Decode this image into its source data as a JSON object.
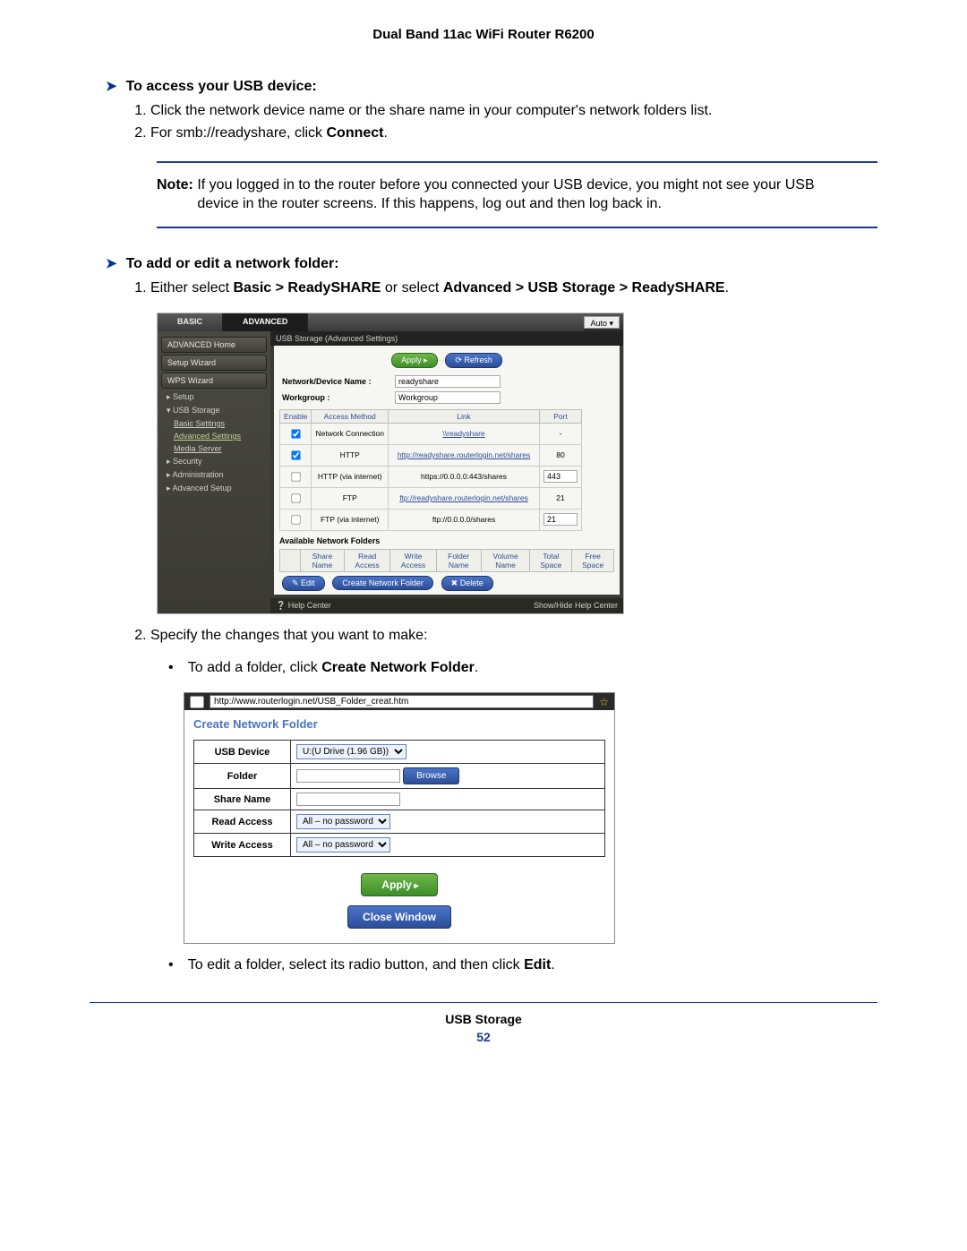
{
  "doc_header": "Dual Band 11ac WiFi Router R6200",
  "sections": {
    "access_heading": "To access your USB device:",
    "access_steps": {
      "s1": "Click the network device name or the share name in your computer's network folders list.",
      "s2_a": "For smb://readyshare, click ",
      "s2_b": "Connect",
      "s2_c": "."
    },
    "note": {
      "label": "Note:",
      "text": "If you logged in to the router before you connected your USB device, you might not see your USB device in the router screens. If this happens, log out and then log back in."
    },
    "edit_heading": "To add or edit a network folder:",
    "edit_step1_a": "Either select ",
    "edit_step1_b": "Basic > ReadySHARE",
    "edit_step1_c": " or select ",
    "edit_step1_d": "Advanced > USB Storage > ReadySHARE",
    "edit_step1_e": ".",
    "edit_step2": "Specify the changes that you want to make:",
    "bullet1_a": "To add a folder, click ",
    "bullet1_b": "Create Network Folder",
    "bullet1_c": ".",
    "bullet2_a": "To edit a folder, select its radio button, and then click ",
    "bullet2_b": "Edit",
    "bullet2_c": "."
  },
  "shot1": {
    "tab_basic": "BASIC",
    "tab_advanced": "ADVANCED",
    "auto": "Auto",
    "nav": {
      "home": "ADVANCED Home",
      "setup_wizard": "Setup Wizard",
      "wps_wizard": "WPS Wizard",
      "setup": "▸ Setup",
      "usb_storage": "▾ USB Storage",
      "basic_settings": "Basic Settings",
      "advanced_settings": "Advanced Settings",
      "media_server": "Media Server",
      "security": "▸ Security",
      "administration": "▸ Administration",
      "advanced_setup": "▸ Advanced Setup"
    },
    "crumb": "USB Storage (Advanced Settings)",
    "apply_btn": "Apply ▸",
    "refresh_btn": "⟳ Refresh",
    "field_device": "Network/Device Name :",
    "val_device": "readyshare",
    "field_workgroup": "Workgroup :",
    "val_workgroup": "Workgroup",
    "th_enable": "Enable",
    "th_method": "Access Method",
    "th_link": "Link",
    "th_port": "Port",
    "rows": [
      {
        "chk": true,
        "method": "Network Connection",
        "link": "\\\\readyshare",
        "port": "-"
      },
      {
        "chk": true,
        "method": "HTTP",
        "link": "http://readyshare.routerlogin.net/shares",
        "port": "80"
      },
      {
        "chk": false,
        "method": "HTTP (via internet)",
        "link": "https://0.0.0.0:443/shares",
        "port": "443"
      },
      {
        "chk": false,
        "method": "FTP",
        "link": "ftp://readyshare.routerlogin.net/shares",
        "port": "21"
      },
      {
        "chk": false,
        "method": "FTP (via internet)",
        "link": "ftp://0.0.0.0/shares",
        "port": "21"
      }
    ],
    "avail_hdr": "Available Network Folders",
    "th2_share": "Share Name",
    "th2_read": "Read Access",
    "th2_write": "Write Access",
    "th2_folder": "Folder Name",
    "th2_volume": "Volume Name",
    "th2_total": "Total Space",
    "th2_free": "Free Space",
    "edit_btn": "✎ Edit",
    "create_btn": "Create Network Folder",
    "delete_btn": "✖ Delete",
    "help_left": "❔ Help Center",
    "help_right": "Show/Hide Help Center"
  },
  "shot2": {
    "url": "http://www.routerlogin.net/USB_Folder_creat.htm",
    "title": "Create Network Folder",
    "rows": {
      "usb_device": "USB Device",
      "usb_val": "U:(U Drive (1.96 GB))",
      "folder": "Folder",
      "browse": "Browse",
      "share_name": "Share Name",
      "read_access": "Read Access",
      "read_val": "All – no password",
      "write_access": "Write Access",
      "write_val": "All – no password"
    },
    "apply": "Apply",
    "close": "Close Window"
  },
  "footer": {
    "section": "USB Storage",
    "page": "52"
  }
}
